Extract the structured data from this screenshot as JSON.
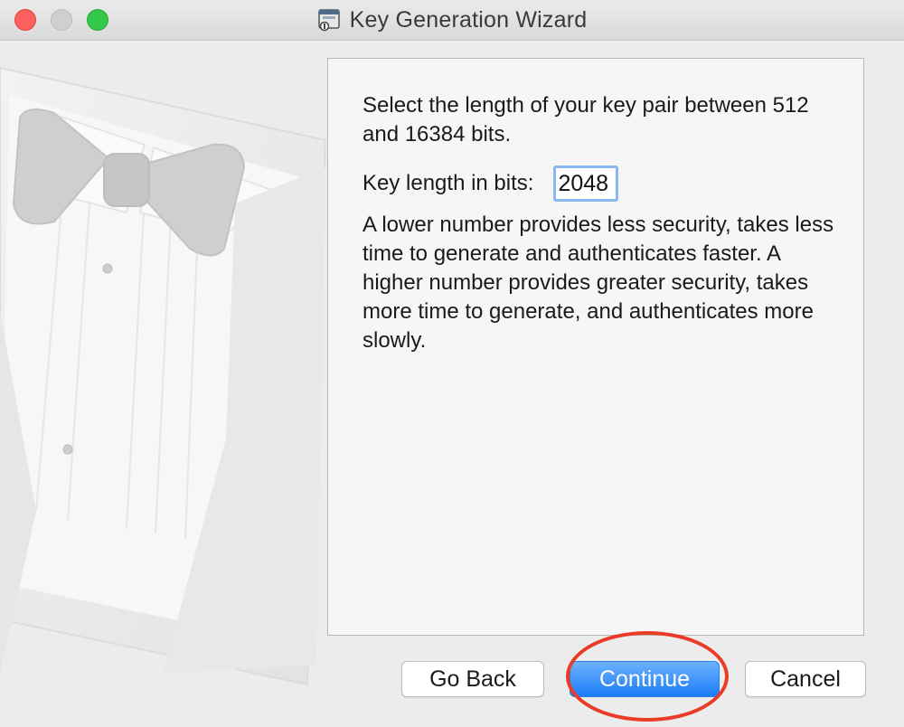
{
  "window": {
    "title": "Key Generation Wizard",
    "icon": "key-wizard-app-icon"
  },
  "traffic_lights": {
    "close": "close-icon",
    "minimize": "minimize-icon",
    "zoom": "zoom-icon"
  },
  "illustration": {
    "icon": "tuxedo-illustration"
  },
  "content": {
    "intro": "Select the length of your key pair between 512 and 16384 bits.",
    "key_length_label": "Key length in bits:",
    "key_length_value": "2048",
    "description": "A lower number provides less security, takes less time to generate and authenticates faster. A higher number provides greater security, takes more time to generate, and authenticates more slowly."
  },
  "buttons": {
    "go_back": "Go Back",
    "continue": "Continue",
    "cancel": "Cancel"
  },
  "annotation": {
    "color": "#ea3b27",
    "target": "continue"
  },
  "colors": {
    "primary_button": "#1b7cf5",
    "focus_ring": "#8ab6f2"
  }
}
